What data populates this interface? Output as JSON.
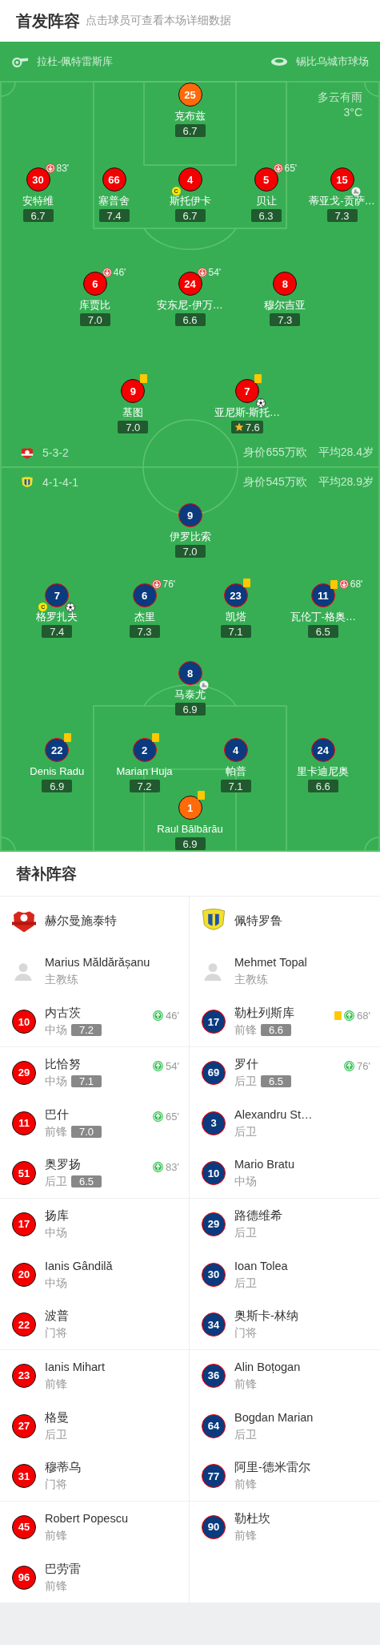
{
  "header": {
    "title": "首发阵容",
    "subtitle": "点击球员可查看本场详细数据"
  },
  "match_info": {
    "referee": "拉杜-佩特雷斯库",
    "stadium": "锡比乌城市球场",
    "weather": "多云有雨",
    "temperature": "3°C"
  },
  "home": {
    "formation": "5-3-2",
    "market_value": "身价655万欧",
    "average_age": "平均28.4岁",
    "lines": [
      {
        "players": [
          {
            "number": "25",
            "name": "克布兹",
            "rating": "6.7",
            "kind": "keeper"
          }
        ]
      },
      {
        "players": [
          {
            "number": "30",
            "name": "安特维",
            "rating": "6.7",
            "kind": "outfield",
            "marks": [
              {
                "kind": "sub_off",
                "minute": "83'"
              }
            ]
          },
          {
            "number": "66",
            "name": "塞普舍",
            "rating": "7.4",
            "kind": "outfield"
          },
          {
            "number": "4",
            "name": "斯托伊卡",
            "rating": "6.7",
            "kind": "outfield",
            "marks": [
              {
                "kind": "captain",
                "label": "C"
              }
            ]
          },
          {
            "number": "5",
            "name": "贝让",
            "rating": "6.3",
            "kind": "outfield",
            "marks": [
              {
                "kind": "sub_off",
                "minute": "65'"
              }
            ]
          },
          {
            "number": "15",
            "name": "蒂亚戈-贡萨…",
            "rating": "7.3",
            "kind": "outfield",
            "marks": [
              {
                "kind": "assist"
              }
            ]
          }
        ]
      },
      {
        "players": [
          {
            "number": "6",
            "name": "库贾比",
            "rating": "7.0",
            "kind": "outfield",
            "marks": [
              {
                "kind": "sub_off",
                "minute": "46'"
              }
            ]
          },
          {
            "number": "24",
            "name": "安东尼-伊万…",
            "rating": "6.6",
            "kind": "outfield",
            "marks": [
              {
                "kind": "sub_off",
                "minute": "54'"
              }
            ]
          },
          {
            "number": "8",
            "name": "穆尔吉亚",
            "rating": "7.3",
            "kind": "outfield"
          }
        ]
      },
      {
        "players": [
          {
            "number": "9",
            "name": "基图",
            "rating": "7.0",
            "kind": "outfield",
            "marks": [
              {
                "kind": "yellow_card"
              }
            ]
          },
          {
            "number": "7",
            "name": "亚尼斯-斯托…",
            "rating": "7.6",
            "kind": "outfield",
            "marks": [
              {
                "kind": "yellow_card"
              },
              {
                "kind": "goal"
              },
              {
                "kind": "best_player"
              }
            ]
          }
        ]
      }
    ]
  },
  "away": {
    "formation": "4-1-4-1",
    "market_value": "身价545万欧",
    "average_age": "平均28.9岁",
    "lines": [
      {
        "players": [
          {
            "number": "9",
            "name": "伊罗比索",
            "rating": "7.0",
            "kind": "outfield"
          }
        ]
      },
      {
        "players": [
          {
            "number": "7",
            "name": "格罗扎夫",
            "rating": "7.4",
            "kind": "outfield",
            "marks": [
              {
                "kind": "captain",
                "label": "C"
              },
              {
                "kind": "goal"
              }
            ]
          },
          {
            "number": "6",
            "name": "杰里",
            "rating": "7.3",
            "kind": "outfield",
            "marks": [
              {
                "kind": "sub_off",
                "minute": "76'"
              }
            ]
          },
          {
            "number": "23",
            "name": "凯塔",
            "rating": "7.1",
            "kind": "outfield",
            "marks": [
              {
                "kind": "yellow_card"
              }
            ]
          },
          {
            "number": "11",
            "name": "瓦伦丁-格奥…",
            "rating": "6.5",
            "kind": "outfield",
            "marks": [
              {
                "kind": "yellow_card"
              },
              {
                "kind": "sub_off",
                "minute": "68'"
              }
            ]
          }
        ]
      },
      {
        "players": [
          {
            "number": "8",
            "name": "马泰尤",
            "rating": "6.9",
            "kind": "outfield",
            "marks": [
              {
                "kind": "assist"
              }
            ]
          }
        ]
      },
      {
        "players": [
          {
            "number": "22",
            "name": "Denis Radu",
            "rating": "6.9",
            "kind": "outfield",
            "marks": [
              {
                "kind": "yellow_card"
              }
            ]
          },
          {
            "number": "2",
            "name": "Marian Huja",
            "rating": "7.2",
            "kind": "outfield",
            "marks": [
              {
                "kind": "yellow_card"
              }
            ]
          },
          {
            "number": "4",
            "name": "帕普",
            "rating": "7.1",
            "kind": "outfield"
          },
          {
            "number": "24",
            "name": "里卡迪尼奥",
            "rating": "6.6",
            "kind": "outfield"
          }
        ]
      },
      {
        "players": [
          {
            "number": "1",
            "name": "Raul Bălbărău",
            "rating": "6.9",
            "kind": "keeper",
            "marks": [
              {
                "kind": "yellow_card"
              }
            ]
          }
        ]
      }
    ]
  },
  "substitutes": {
    "title": "替补阵容",
    "teams": [
      {
        "name": "赫尔曼施泰特",
        "coach": {
          "name": "Marius Măldărășanu",
          "role": "主教练"
        },
        "players": [
          {
            "number": "10",
            "name": "内古茨",
            "position": "中场",
            "rating": "7.2",
            "yellow_card": false,
            "sub_on": "46'"
          },
          {
            "number": "29",
            "name": "比恰努",
            "position": "中场",
            "rating": "7.1",
            "yellow_card": false,
            "sub_on": "54'"
          },
          {
            "number": "11",
            "name": "巴什",
            "position": "前锋",
            "rating": "7.0",
            "yellow_card": false,
            "sub_on": "65'"
          },
          {
            "number": "51",
            "name": "奥罗扬",
            "position": "后卫",
            "rating": "6.5",
            "yellow_card": false,
            "sub_on": "83'"
          },
          {
            "number": "17",
            "name": "扬库",
            "position": "中场",
            "yellow_card": false
          },
          {
            "number": "20",
            "name": "Ianis Gândilă",
            "position": "中场",
            "yellow_card": false
          },
          {
            "number": "22",
            "name": "波普",
            "position": "门将",
            "yellow_card": false
          },
          {
            "number": "23",
            "name": "Ianis Mihart",
            "position": "前锋",
            "yellow_card": false
          },
          {
            "number": "27",
            "name": "格曼",
            "position": "后卫",
            "yellow_card": false
          },
          {
            "number": "31",
            "name": "穆蒂乌",
            "position": "门将",
            "yellow_card": false
          },
          {
            "number": "45",
            "name": "Robert Popescu",
            "position": "前锋",
            "yellow_card": false
          },
          {
            "number": "96",
            "name": "巴劳雷",
            "position": "前锋",
            "yellow_card": false
          }
        ]
      },
      {
        "name": "佩特罗鲁",
        "coach": {
          "name": "Mehmet Topal",
          "role": "主教练"
        },
        "players": [
          {
            "number": "17",
            "name": "勒杜列斯库",
            "position": "前锋",
            "rating": "6.6",
            "yellow_card": true,
            "sub_on": "68'"
          },
          {
            "number": "69",
            "name": "罗什",
            "position": "后卫",
            "rating": "6.5",
            "yellow_card": false,
            "sub_on": "76'"
          },
          {
            "number": "3",
            "name": "Alexandru St…",
            "position": "后卫",
            "yellow_card": false
          },
          {
            "number": "10",
            "name": "Mario Bratu",
            "position": "中场",
            "yellow_card": false
          },
          {
            "number": "29",
            "name": "路德维希",
            "position": "后卫",
            "yellow_card": false
          },
          {
            "number": "30",
            "name": "Ioan Tolea",
            "position": "后卫",
            "yellow_card": false
          },
          {
            "number": "34",
            "name": "奥斯卡-林纳",
            "position": "门将",
            "yellow_card": false
          },
          {
            "number": "36",
            "name": "Alin Boțogan",
            "position": "前锋",
            "yellow_card": false
          },
          {
            "number": "64",
            "name": "Bogdan Marian",
            "position": "后卫",
            "yellow_card": false
          },
          {
            "number": "77",
            "name": "阿里-德米雷尔",
            "position": "前锋",
            "yellow_card": false
          },
          {
            "number": "90",
            "name": "勒杜坎",
            "position": "前锋",
            "yellow_card": false
          }
        ]
      }
    ]
  }
}
